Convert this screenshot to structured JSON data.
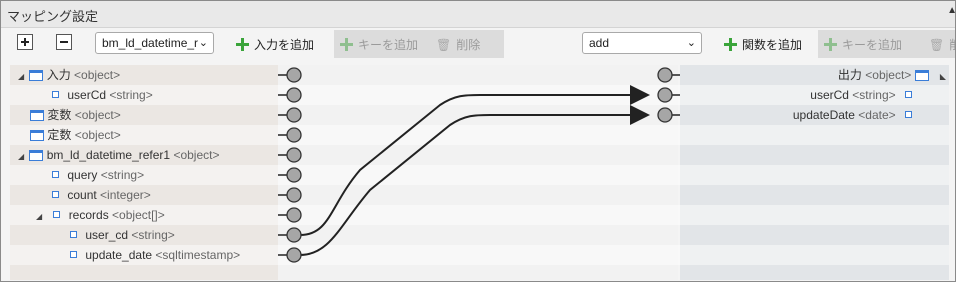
{
  "window": {
    "title": "マッピング設定"
  },
  "toolbar": {
    "expand_icon": "plus-square-icon",
    "collapse_icon": "minus-square-icon",
    "input_select_value": "bm_ld_datetime_r",
    "add_input_label": "入力を追加",
    "add_key_label_left": "キーを追加",
    "delete_label_left": "削除",
    "function_select_value": "add",
    "add_function_label": "関数を追加",
    "add_key_label_right": "キーを追加",
    "delete_label_right": "削"
  },
  "input_tree": [
    {
      "label": "入力",
      "type": "<object>",
      "kind": "object",
      "level": 0,
      "expanded": true
    },
    {
      "label": "userCd",
      "type": "<string>",
      "kind": "leaf",
      "level": 1
    },
    {
      "label": "変数",
      "type": "<object>",
      "kind": "object",
      "level": 0
    },
    {
      "label": "定数",
      "type": "<object>",
      "kind": "object",
      "level": 0
    },
    {
      "label": "bm_ld_datetime_refer1",
      "type": "<object>",
      "kind": "object",
      "level": 0,
      "expanded": true
    },
    {
      "label": "query",
      "type": "<string>",
      "kind": "leaf",
      "level": 1
    },
    {
      "label": "count",
      "type": "<integer>",
      "kind": "leaf",
      "level": 1
    },
    {
      "label": "records",
      "type": "<object[]>",
      "kind": "leaf",
      "level": 1,
      "expanded": true
    },
    {
      "label": "user_cd",
      "type": "<string>",
      "kind": "leaf",
      "level": 2
    },
    {
      "label": "update_date",
      "type": "<sqltimestamp>",
      "kind": "leaf",
      "level": 2
    }
  ],
  "output_tree": [
    {
      "label": "出力",
      "type": "<object>",
      "kind": "object"
    },
    {
      "label": "userCd",
      "type": "<string>",
      "kind": "leaf"
    },
    {
      "label": "updateDate",
      "type": "<date>",
      "kind": "leaf"
    }
  ],
  "mappings": [
    {
      "from": "user_cd",
      "to": "userCd"
    },
    {
      "from": "update_date",
      "to": "updateDate"
    }
  ],
  "colors": {
    "accent_plus": "#3aa43a",
    "tree_icon": "#3a7dd8",
    "connector": "#999999",
    "wire": "#222222"
  }
}
